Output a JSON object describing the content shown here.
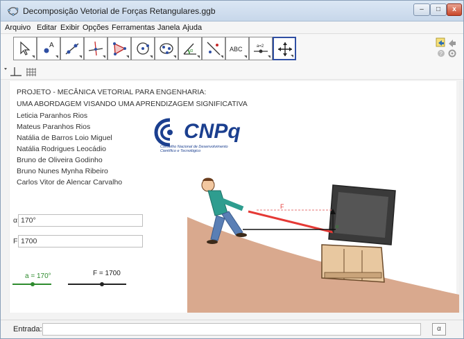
{
  "window": {
    "title": "Decomposição Vetorial de Forças Retangulares.ggb"
  },
  "menu": [
    "Arquivo",
    "Editar",
    "Exibir",
    "Opções",
    "Ferramentas",
    "Janela",
    "Ajuda"
  ],
  "toolbar": {
    "tools": [
      "move",
      "point",
      "line",
      "perpendicular",
      "polygon",
      "circle",
      "ellipse",
      "angle",
      "reflect",
      "text",
      "slider",
      "move-graphics-view"
    ],
    "selected_tool": "move-graphics-view",
    "text_tool_label": "ABC",
    "slider_tool_label": "a=2"
  },
  "text_block": [
    "PROJETO - MECÂNICA VETORIAL PARA ENGENHARIA:",
    "UMA ABORDAGEM VISANDO UMA APRENDIZAGEM SIGNIFICATIVA",
    "Leticia Paranhos Rios",
    "Mateus Paranhos Rios",
    "Natália de Barros Loio Miguel",
    "Natália Rodrigues Leocádio",
    "Bruno de Oliveira Godinho",
    "Bruno Nunes Mynha Ribeiro",
    "Carlos Vitor de Alencar Carvalho"
  ],
  "logo": {
    "name": "CNPq",
    "subtitle_line1": "Conselho Nacional de Desenvolvimento",
    "subtitle_line2": "Científico e Tecnológico",
    "color": "#1b3f8f"
  },
  "inputs": {
    "angle": {
      "label": "α",
      "value": "170°"
    },
    "force": {
      "label": "F",
      "value": "1700"
    }
  },
  "sliders": {
    "angle": {
      "caption": "a = 170°",
      "value": 170,
      "color": "#2e8b2e"
    },
    "force": {
      "caption": "F = 1700",
      "value": 1700,
      "color": "#222222"
    }
  },
  "scene": {
    "force_label": "F",
    "angle_label": "α",
    "vector_color": "#e53935",
    "ramp_color": "#d9a98e"
  },
  "entrada": {
    "label": "Entrada:",
    "value": ""
  }
}
